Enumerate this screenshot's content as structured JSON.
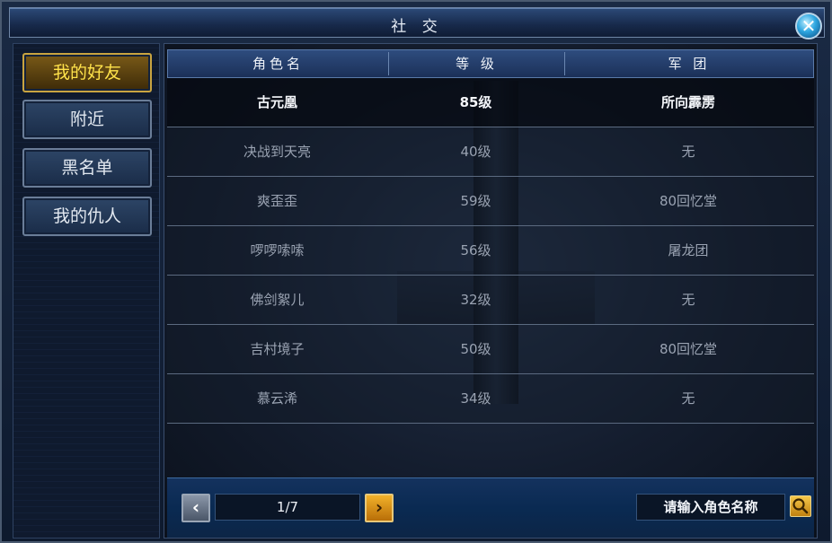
{
  "window": {
    "title": "社 交",
    "close_label": "✕"
  },
  "sidebar": {
    "items": [
      {
        "label": "我的好友",
        "active": true
      },
      {
        "label": "附近",
        "active": false
      },
      {
        "label": "黑名单",
        "active": false
      },
      {
        "label": "我的仇人",
        "active": false
      }
    ]
  },
  "table": {
    "headers": [
      "角色名",
      "等 级",
      "军 团"
    ],
    "rows": [
      {
        "name": "古元凰",
        "level": "85级",
        "legion": "所向霹雳"
      },
      {
        "name": "决战到天亮",
        "level": "40级",
        "legion": "无"
      },
      {
        "name": "爽歪歪",
        "level": "59级",
        "legion": "80回忆堂"
      },
      {
        "name": "啰啰嗦嗦",
        "level": "56级",
        "legion": "屠龙团"
      },
      {
        "name": "佛剑絮儿",
        "level": "32级",
        "legion": "无"
      },
      {
        "name": "吉村境子",
        "level": "50级",
        "legion": "80回忆堂"
      },
      {
        "name": "慕云浠",
        "level": "34级",
        "legion": "无"
      }
    ]
  },
  "pager": {
    "page": "1/7",
    "prev_icon": "chevron-left-icon",
    "next_icon": "chevron-right-icon"
  },
  "search": {
    "placeholder": "请输入角色名称",
    "icon": "search-icon"
  }
}
